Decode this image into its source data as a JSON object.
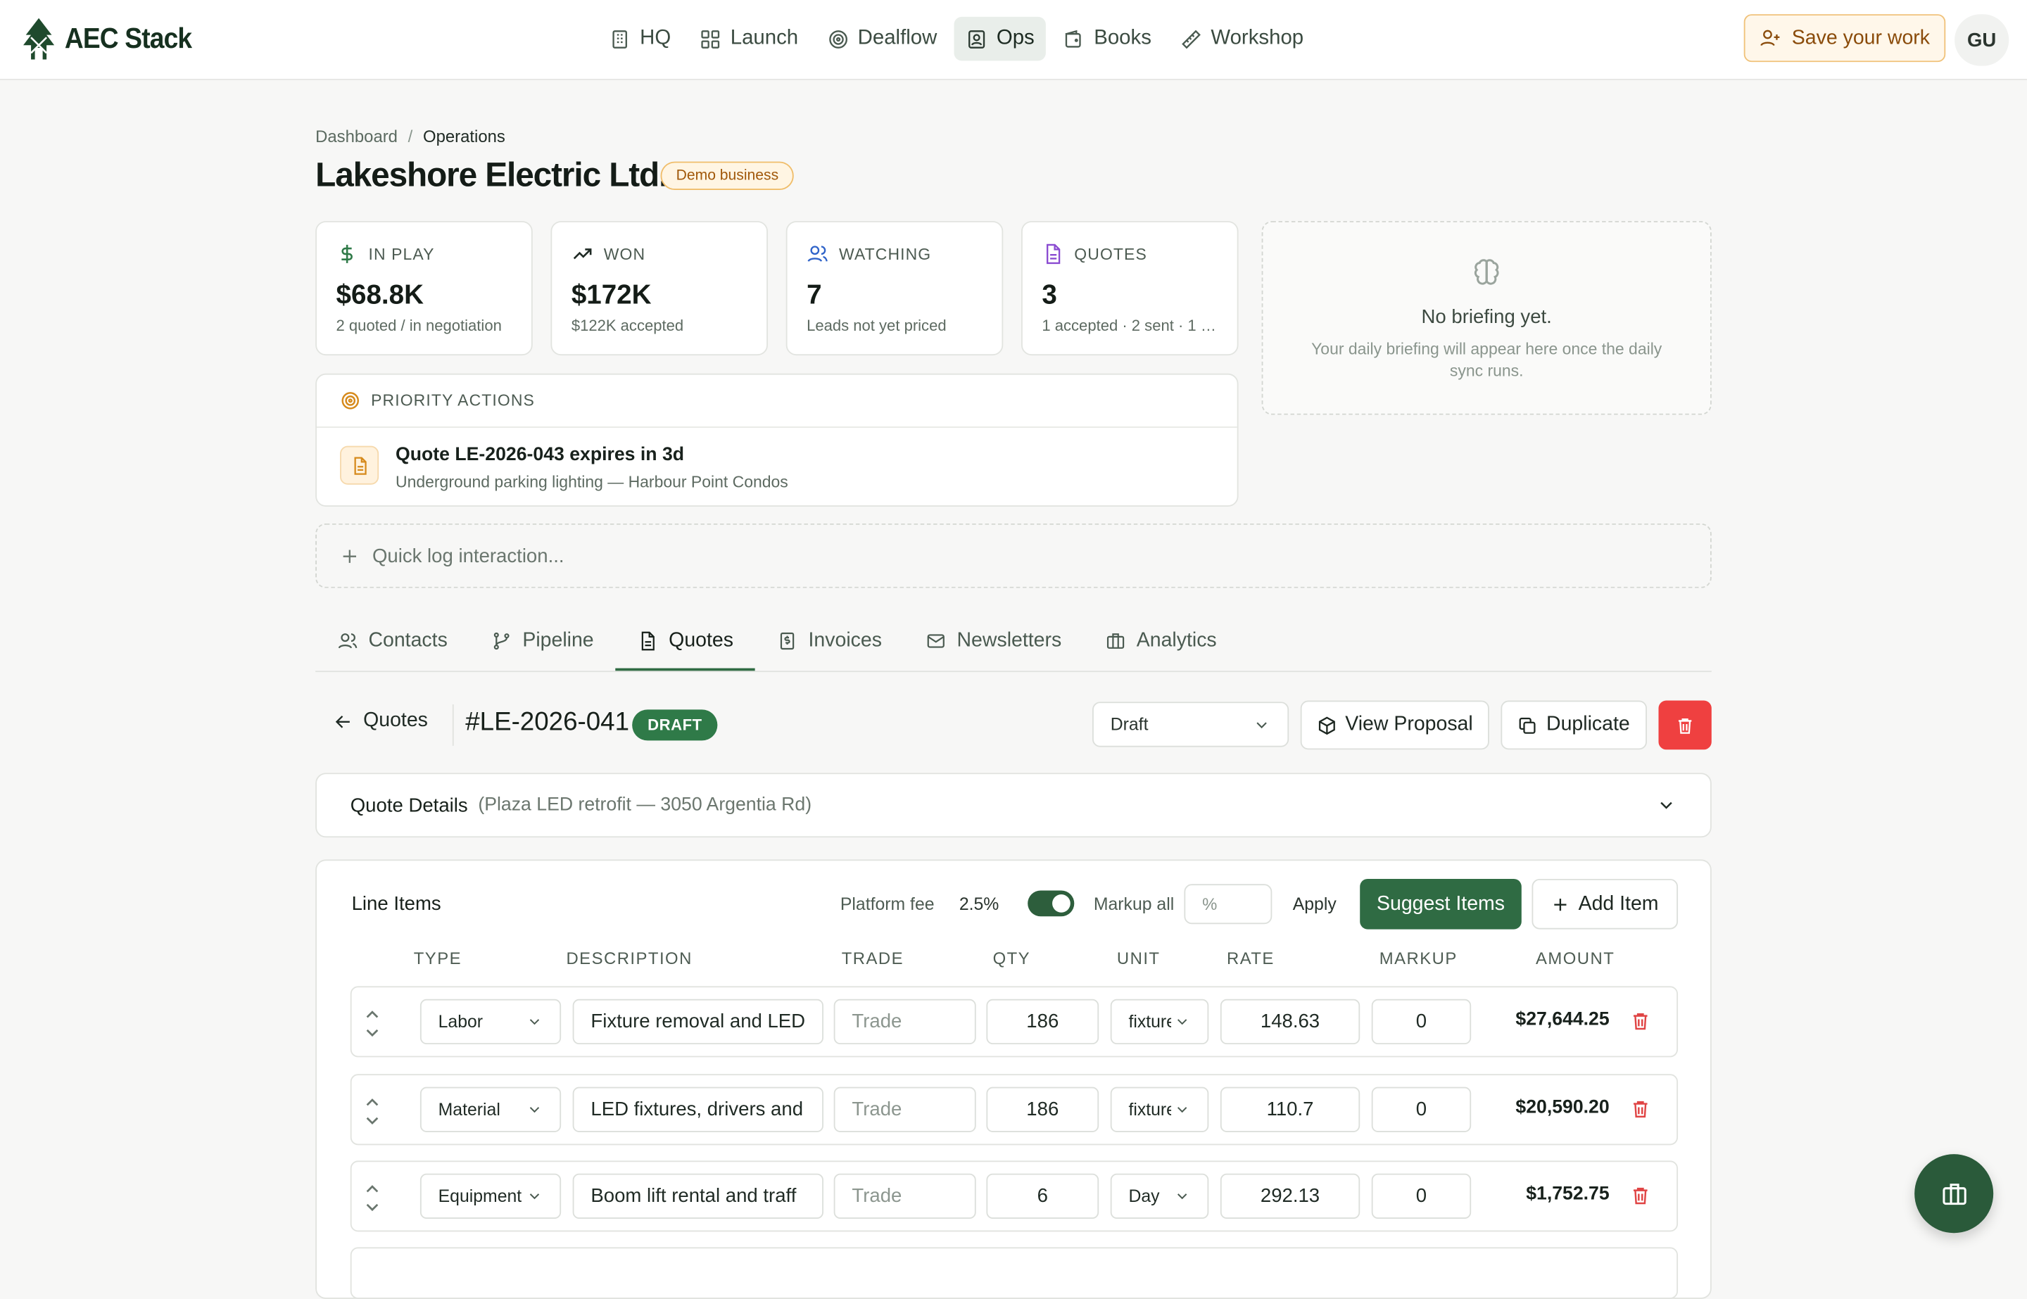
{
  "app": {
    "name": "AEC Stack"
  },
  "nav": {
    "items": [
      {
        "label": "HQ",
        "icon": "building-icon"
      },
      {
        "label": "Launch",
        "icon": "grid-icon"
      },
      {
        "label": "Dealflow",
        "icon": "target-icon"
      },
      {
        "label": "Ops",
        "icon": "contact-card-icon",
        "active": true
      },
      {
        "label": "Books",
        "icon": "wallet-icon"
      },
      {
        "label": "Workshop",
        "icon": "ruler-icon"
      }
    ],
    "save_label": "Save your work",
    "avatar_initials": "GU"
  },
  "breadcrumb": {
    "root": "Dashboard",
    "separator": "/",
    "current": "Operations"
  },
  "page": {
    "title": "Lakeshore Electric Ltd.",
    "badge": "Demo business"
  },
  "stats": [
    {
      "label": "IN PLAY",
      "value": "$68.8K",
      "sub": "2 quoted / in negotiation",
      "icon": "dollar-icon",
      "color": "#2f7a48"
    },
    {
      "label": "WON",
      "value": "$172K",
      "sub": "$122K accepted",
      "icon": "trending-up-icon",
      "color": "#1f2a24"
    },
    {
      "label": "WATCHING",
      "value": "7",
      "sub": "Leads not yet priced",
      "icon": "users-icon",
      "color": "#2f63c9"
    },
    {
      "label": "QUOTES",
      "value": "3",
      "sub": "1 accepted · 2 sent · 1 d...",
      "icon": "document-icon",
      "color": "#8a4bd1"
    }
  ],
  "briefing": {
    "title": "No briefing yet.",
    "text": "Your daily briefing will appear here once the daily sync runs."
  },
  "priority": {
    "heading": "PRIORITY ACTIONS",
    "items": [
      {
        "title": "Quote LE-2026-043 expires in 3d",
        "sub": "Underground parking lighting — Harbour Point Condos"
      }
    ]
  },
  "quick_log": {
    "placeholder": "Quick log interaction..."
  },
  "tabs": [
    {
      "label": "Contacts",
      "icon": "users-icon"
    },
    {
      "label": "Pipeline",
      "icon": "branch-icon"
    },
    {
      "label": "Quotes",
      "icon": "document-icon",
      "active": true
    },
    {
      "label": "Invoices",
      "icon": "invoice-icon"
    },
    {
      "label": "Newsletters",
      "icon": "mail-icon"
    },
    {
      "label": "Analytics",
      "icon": "briefcase-icon"
    }
  ],
  "quote": {
    "back_label": "Quotes",
    "number": "#LE-2026-041",
    "status_badge": "DRAFT",
    "status_select": "Draft",
    "view_proposal_label": "View Proposal",
    "duplicate_label": "Duplicate",
    "details_title": "Quote Details",
    "details_sub": "(Plaza LED retrofit — 3050 Argentia Rd)"
  },
  "line_items": {
    "title": "Line Items",
    "platform_fee_label": "Platform fee",
    "platform_fee_value": "2.5%",
    "markup_all_label": "Markup all",
    "markup_placeholder": "%",
    "apply_label": "Apply",
    "suggest_label": "Suggest Items",
    "add_label": "Add Item",
    "columns": [
      "TYPE",
      "DESCRIPTION",
      "TRADE",
      "QTY",
      "UNIT",
      "RATE",
      "MARKUP",
      "AMOUNT"
    ],
    "trade_placeholder": "Trade",
    "rows": [
      {
        "type": "Labor",
        "description": "Fixture removal and LED",
        "qty": "186",
        "unit": "fixture",
        "rate": "148.63",
        "markup": "0",
        "amount": "$27,644.25"
      },
      {
        "type": "Material",
        "description": "LED fixtures, drivers and",
        "qty": "186",
        "unit": "fixture",
        "rate": "110.7",
        "markup": "0",
        "amount": "$20,590.20"
      },
      {
        "type": "Equipment",
        "description": "Boom lift rental and traff",
        "qty": "6",
        "unit": "Day",
        "rate": "292.13",
        "markup": "0",
        "amount": "$1,752.75"
      }
    ]
  },
  "colors": {
    "brand": "#2f6b43",
    "danger": "#ef4040",
    "accent_warm": "#f0c27a"
  }
}
